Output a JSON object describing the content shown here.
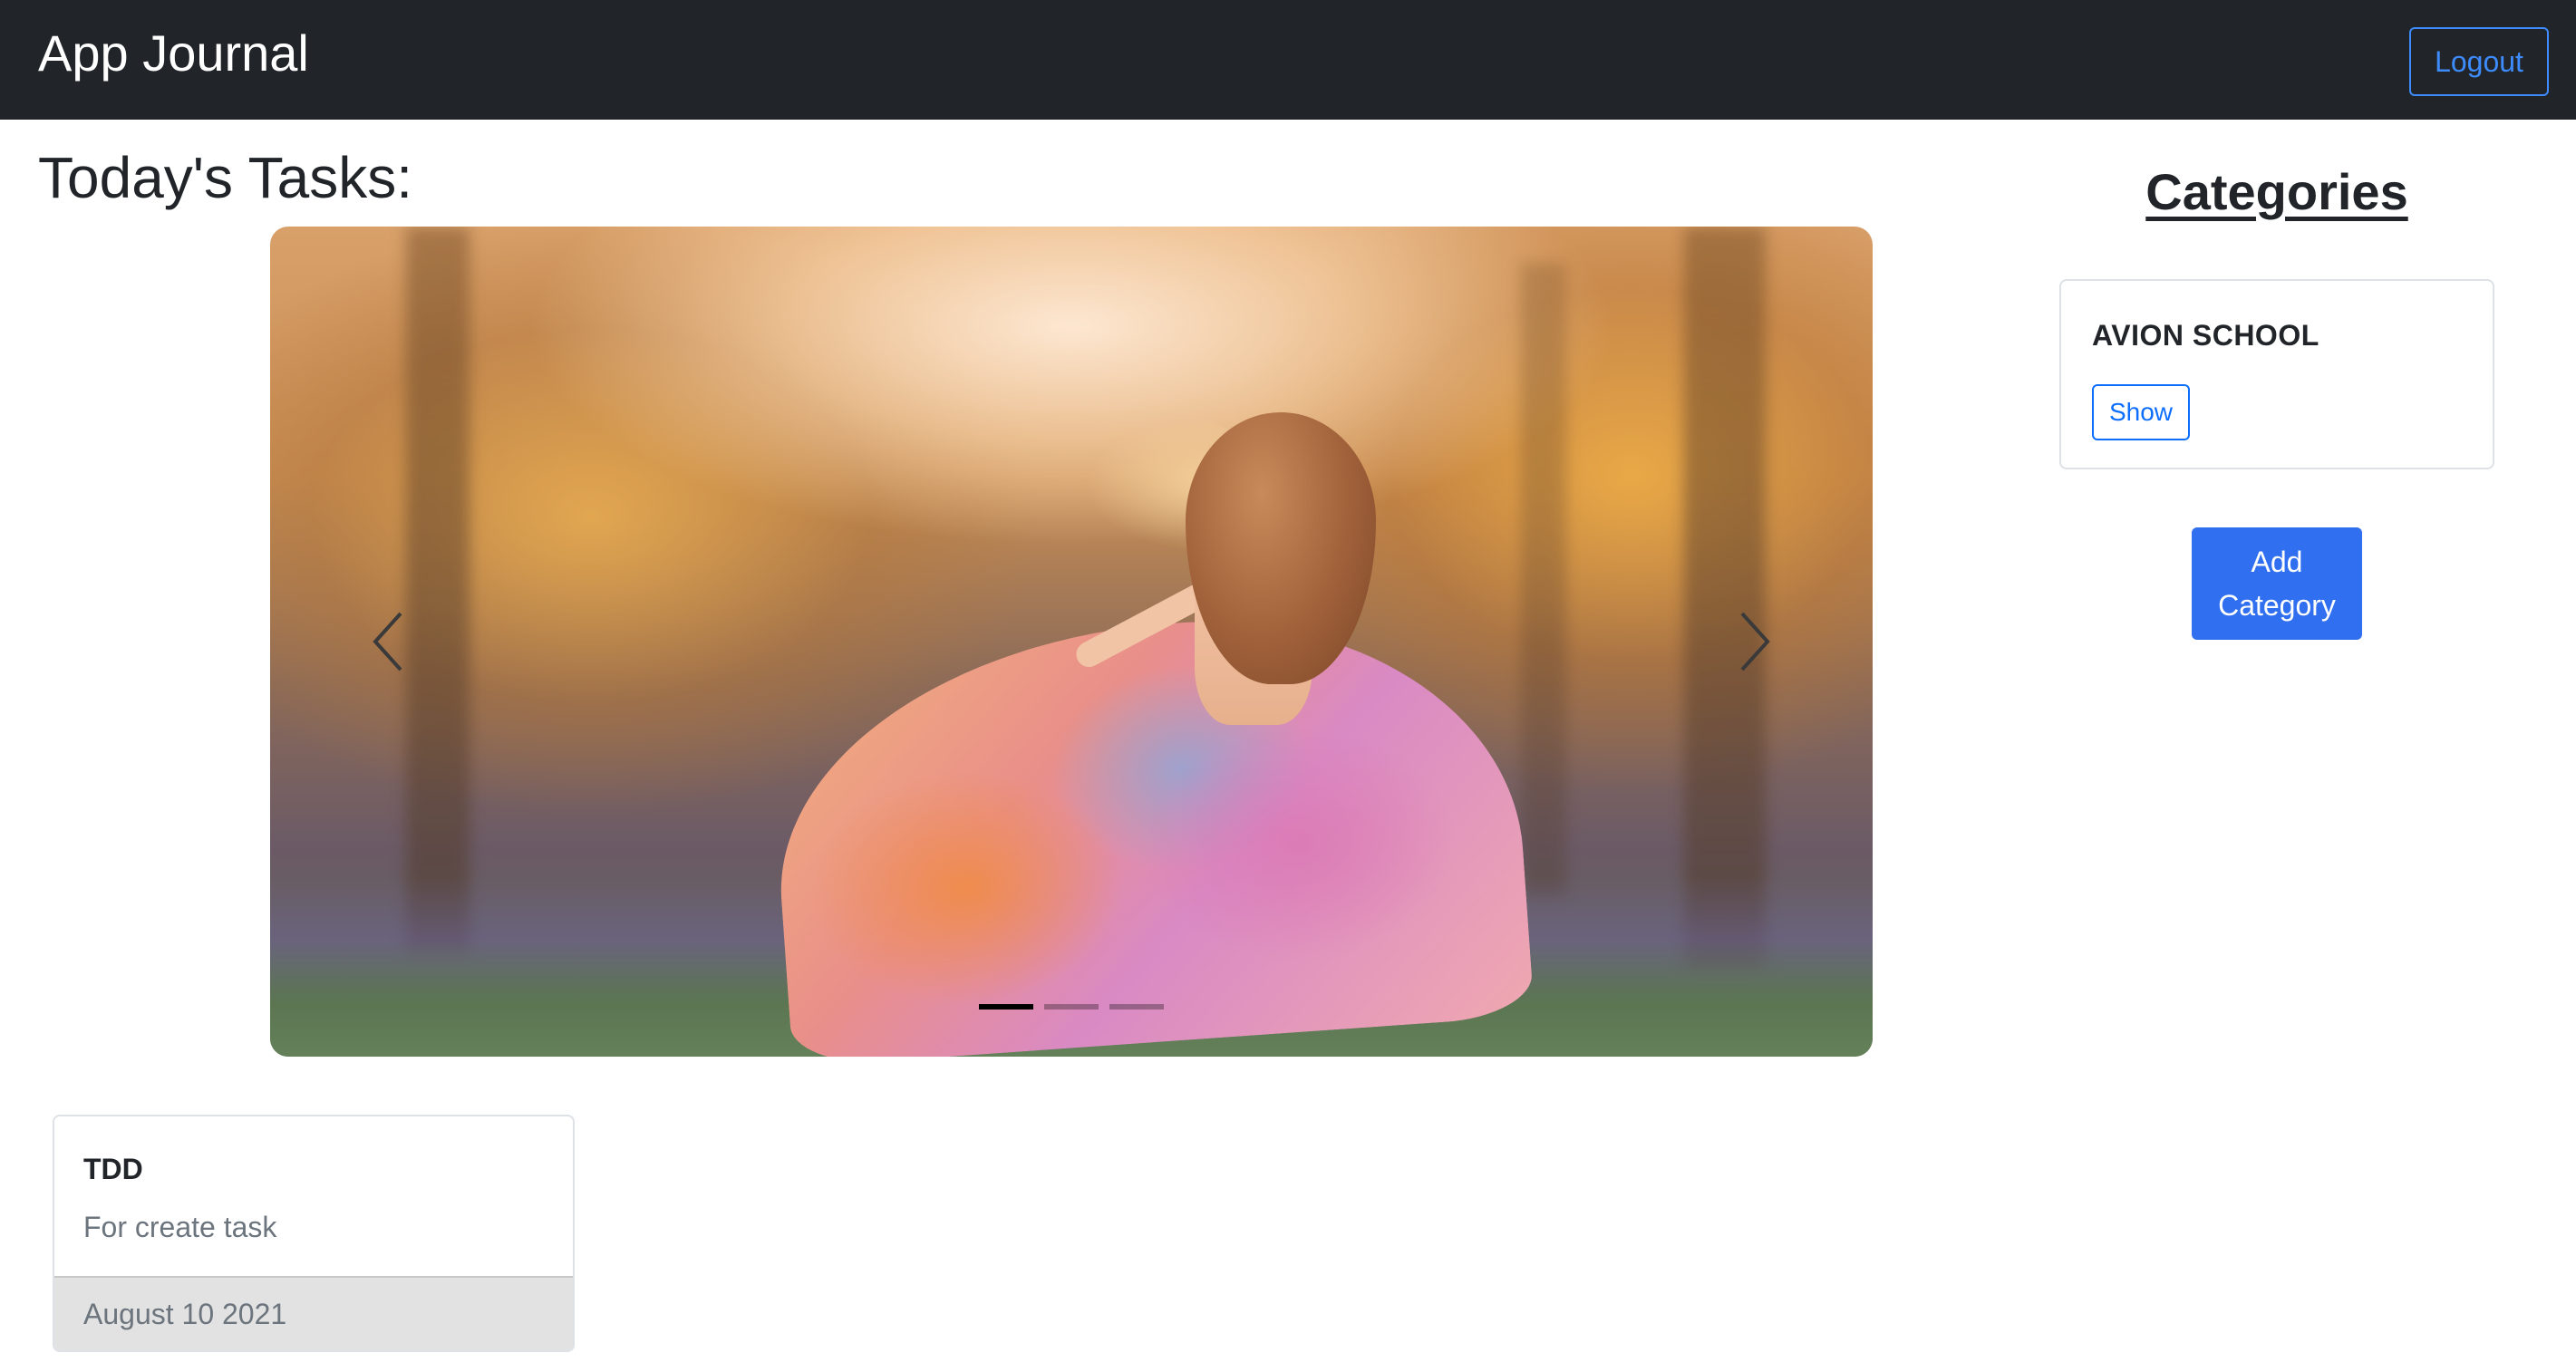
{
  "navbar": {
    "brand": "App Journal",
    "logout_label": "Logout"
  },
  "main": {
    "title": "Today's Tasks:",
    "carousel": {
      "slide_count": 3,
      "active_index": 0,
      "prev_icon": "chevron-left-icon",
      "next_icon": "chevron-right-icon"
    }
  },
  "sidebar": {
    "title": "Categories",
    "categories": [
      {
        "name": "AVION SCHOOL",
        "show_label": "Show"
      }
    ],
    "add_label": "Add Category"
  },
  "tasks": [
    {
      "title": "TDD",
      "description": "For create task",
      "date": "August 10 2021"
    }
  ],
  "colors": {
    "navbar_bg": "#212529",
    "primary": "#0d6efd",
    "card_footer_bg": "#e2e2e2"
  }
}
